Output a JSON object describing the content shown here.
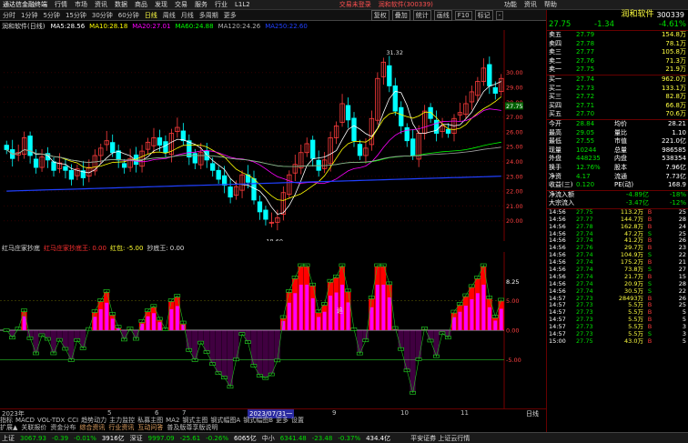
{
  "app": {
    "title": "通达信金融终端",
    "top_menu": [
      "行情",
      "市场",
      "资讯",
      "数据",
      "商品",
      "发现",
      "交易",
      "服务",
      "行业",
      "L1L2"
    ],
    "notices": [
      "交易未登录",
      "润和软件(300339)"
    ],
    "win_buttons": [
      "功能",
      "资讯",
      "帮助"
    ]
  },
  "toolbar": {
    "periods": [
      "分时",
      "1分钟",
      "5分钟",
      "15分钟",
      "30分钟",
      "60分钟",
      "日线",
      "周线",
      "月线",
      "多周期",
      "更多"
    ],
    "active": "日线",
    "right": [
      "复权",
      "叠加",
      "统计",
      "画线",
      "F10",
      "标记",
      "-"
    ]
  },
  "chart_title": {
    "label": "润和软件(日线)",
    "ma": [
      {
        "name": "MA5:",
        "value": "28.56",
        "color": "#ffffff"
      },
      {
        "name": "MA10:",
        "value": "28.18",
        "color": "#ffff00"
      },
      {
        "name": "MA20:",
        "value": "27.01",
        "color": "#ff00ff"
      },
      {
        "name": "MA60:",
        "value": "24.88",
        "color": "#00ff00"
      },
      {
        "name": "MA120:",
        "value": "24.26",
        "color": "#b0b0b0"
      },
      {
        "name": "MA250:",
        "value": "22.60",
        "color": "#2040ff"
      }
    ]
  },
  "chart_data": [
    {
      "type": "candlestick",
      "ylim": [
        19,
        32.5
      ],
      "yticks": [
        "30.00",
        "29.00",
        "28.00",
        "27.00",
        "26.00",
        "25.00",
        "24.00",
        "23.00",
        "22.00",
        "21.00",
        "20.00"
      ],
      "annotations": [
        {
          "text": "31.32",
          "note": "high"
        },
        {
          "text": "18.60",
          "note": "low"
        }
      ],
      "series_close": [
        24.8,
        24.2,
        24.6,
        25.6,
        24.4,
        23.6,
        24.3,
        24.1,
        23.4,
        23.9,
        23.4,
        22.8,
        23.5,
        22.9,
        23.6,
        24.4,
        24.9,
        25.4,
        24.6,
        24.1,
        23.6,
        24.2,
        23.8,
        24.7,
        25.3,
        25.6,
        25.1,
        24.6,
        25.9,
        26.3,
        25.4,
        24.3,
        23.9,
        24.6,
        24.1,
        23.4,
        22.8,
        22.4,
        21.6,
        22.3,
        23.1,
        22.6,
        21.4,
        20.6,
        20.1,
        19.9,
        20.2,
        21.9,
        23.1,
        23.8,
        24.6,
        25.2,
        24.2,
        23.4,
        24.1,
        25.6,
        26.4,
        27.9,
        26.8,
        25.4,
        24.4,
        24.9,
        26.9,
        29.6,
        30.7,
        29.1,
        27.4,
        26.4,
        25.4,
        24.4,
        25.9,
        27.4,
        26.9,
        25.9,
        26.4,
        25.9,
        26.9,
        27.3,
        27.9,
        28.7,
        29.4,
        30.3,
        29.1,
        28.6,
        29.6
      ]
    },
    {
      "type": "step-indicator",
      "name": "红马庄家抄底",
      "legend": [
        "红马庄家抄底",
        "红马庄家抄底王:",
        "0.00",
        "红包:",
        "-5.00",
        "抄底王:",
        "0.00"
      ],
      "ylim": [
        -12,
        12
      ],
      "yticks": [
        "8.25",
        "5.00",
        "0.00",
        "-5.00"
      ],
      "tag": "追"
    }
  ],
  "xaxis": {
    "labels": [
      "2023年",
      "5",
      "6",
      "7",
      "2023/07/31一",
      "9",
      "10",
      "11"
    ],
    "right": "日线"
  },
  "bottom_tabs": [
    "指标",
    "MACD",
    "VOL-TDX",
    "CCI",
    "趋势动力",
    "主力监控",
    "私募主图",
    "MA2",
    "钢式主图",
    "钢式幅图A",
    "钢式幅图B",
    "更多",
    "设置"
  ],
  "links": [
    "扩展▲",
    "关联报价",
    "资金分布",
    "综合资讯",
    "行业资讯",
    "互动问答",
    "普及版尊享版说明"
  ],
  "status": [
    {
      "label": "上证",
      "value": "3067.93",
      "chg": "-0.39",
      "pct": "-0.01%",
      "amt": "3916亿"
    },
    {
      "label": "深证",
      "value": "9997.09",
      "chg": "-25.61",
      "pct": "-0.26%",
      "amt": "6065亿"
    },
    {
      "label": "中小",
      "value": "6341.48",
      "chg": "-23.48",
      "pct": "-0.37%",
      "amt": "434.4亿"
    }
  ],
  "status_right": "平安证券 上证云行情",
  "quote": {
    "name": "润和软件",
    "code": "300339",
    "price": "27.75",
    "change": "-1.34",
    "pct": "-4.61%",
    "sells": [
      [
        "卖五",
        "27.79",
        "154.8万"
      ],
      [
        "卖四",
        "27.78",
        "78.1万"
      ],
      [
        "卖三",
        "27.77",
        "105.8万"
      ],
      [
        "卖二",
        "27.76",
        "71.3万"
      ],
      [
        "卖一",
        "27.75",
        "21.9万"
      ]
    ],
    "buys": [
      [
        "买一",
        "27.74",
        "962.0万"
      ],
      [
        "买二",
        "27.73",
        "133.1万"
      ],
      [
        "买三",
        "27.72",
        "82.8万"
      ],
      [
        "买四",
        "27.71",
        "66.8万"
      ],
      [
        "买五",
        "27.70",
        "70.6万"
      ]
    ],
    "stats": [
      [
        "今开",
        "28.84",
        "均价",
        "28.21"
      ],
      [
        "最高",
        "29.05",
        "量比",
        "1.10"
      ],
      [
        "最低",
        "27.55",
        "市值",
        "221.0亿"
      ],
      [
        "现量",
        "10244",
        "总量",
        "986585"
      ],
      [
        "外盘",
        "448235",
        "内盘",
        "538354"
      ],
      [
        "换手",
        "12.76%",
        "股本",
        "7.96亿"
      ],
      [
        "净资",
        "4.17",
        "流通",
        "7.73亿"
      ],
      [
        "收益(三)",
        "0.120",
        "PE(动)",
        "168.9"
      ]
    ],
    "flows": [
      [
        "净流入额",
        "-4.89亿",
        "-18%"
      ],
      [
        "大宗流入",
        "-3.47亿",
        "-12%"
      ]
    ],
    "ticks": [
      [
        "14:56",
        "27.75",
        "113.2万",
        "B",
        "25"
      ],
      [
        "14:56",
        "27.77",
        "144.7万",
        "B",
        "28"
      ],
      [
        "14:56",
        "27.78",
        "162.8万",
        "B",
        "24"
      ],
      [
        "14:56",
        "27.74",
        "47.2万",
        "S",
        "25"
      ],
      [
        "14:56",
        "27.74",
        "41.2万",
        "B",
        "26"
      ],
      [
        "14:56",
        "27.76",
        "29.7万",
        "B",
        "23"
      ],
      [
        "14:56",
        "27.74",
        "104.9万",
        "S",
        "22"
      ],
      [
        "14:56",
        "27.74",
        "175.2万",
        "B",
        "21"
      ],
      [
        "14:56",
        "27.74",
        "73.8万",
        "S",
        "27"
      ],
      [
        "14:56",
        "27.74",
        "21.7万",
        "B",
        "15"
      ],
      [
        "14:56",
        "27.74",
        "20.9万",
        "S",
        "28"
      ],
      [
        "14:56",
        "27.74",
        "30.5万",
        "S",
        "22"
      ],
      [
        "14:57",
        "27.73",
        "28493万",
        "B",
        "26"
      ],
      [
        "14:57",
        "27.73",
        "5.5万",
        "B",
        "25"
      ],
      [
        "14:57",
        "27.73",
        "5.5万",
        "B",
        "5"
      ],
      [
        "14:57",
        "27.73",
        "5.5万",
        "B",
        "5"
      ],
      [
        "14:57",
        "27.73",
        "5.5万",
        "B",
        "3"
      ],
      [
        "14:57",
        "27.73",
        "5.5万",
        "S",
        "3"
      ],
      [
        "15:00",
        "27.75",
        "43.0万",
        "B",
        "5"
      ]
    ]
  }
}
